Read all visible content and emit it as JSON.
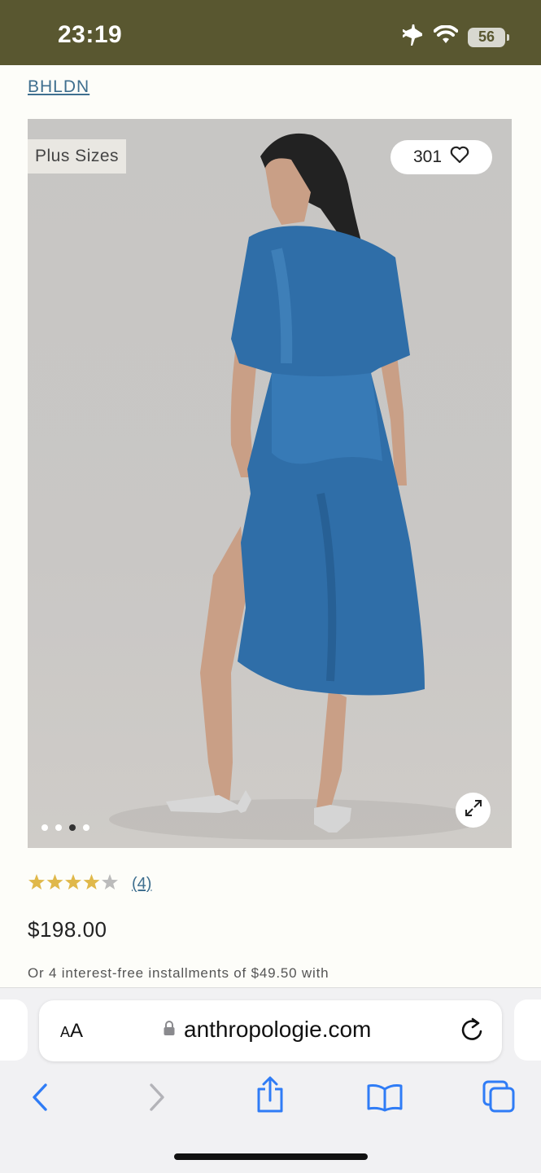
{
  "status": {
    "time": "23:19",
    "battery": "56",
    "icons": [
      "airplane-icon",
      "wifi-icon",
      "battery-icon"
    ]
  },
  "product": {
    "brand": "BHLDN",
    "badge": "Plus Sizes",
    "favorites_count": "301",
    "image": {
      "description_icon": "product-photo",
      "carousel_total": 4,
      "carousel_active_index": 2
    },
    "rating": {
      "stars": 4,
      "max": 5,
      "count_label": "(4)"
    },
    "price": "$198.00",
    "installments_text": "Or 4 interest-free installments of $49.50 with"
  },
  "browser": {
    "text_size_label_big": "A",
    "text_size_label_small": "A",
    "url": "anthropologie.com",
    "toolbar": [
      "back-icon",
      "forward-icon",
      "share-icon",
      "bookmarks-icon",
      "tabs-icon"
    ]
  },
  "colors": {
    "status_bar": "#595730",
    "link": "#3f6f8f",
    "star": "#e0b84a",
    "star_empty": "#bbbbbb",
    "ios_blue": "#2f7cf6"
  }
}
